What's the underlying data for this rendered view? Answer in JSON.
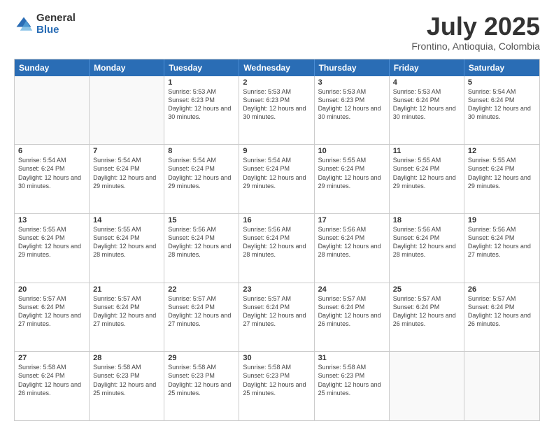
{
  "logo": {
    "general": "General",
    "blue": "Blue"
  },
  "title": "July 2025",
  "location": "Frontino, Antioquia, Colombia",
  "header_days": [
    "Sunday",
    "Monday",
    "Tuesday",
    "Wednesday",
    "Thursday",
    "Friday",
    "Saturday"
  ],
  "rows": [
    [
      {
        "day": "",
        "info": ""
      },
      {
        "day": "",
        "info": ""
      },
      {
        "day": "1",
        "info": "Sunrise: 5:53 AM\nSunset: 6:23 PM\nDaylight: 12 hours and 30 minutes."
      },
      {
        "day": "2",
        "info": "Sunrise: 5:53 AM\nSunset: 6:23 PM\nDaylight: 12 hours and 30 minutes."
      },
      {
        "day": "3",
        "info": "Sunrise: 5:53 AM\nSunset: 6:23 PM\nDaylight: 12 hours and 30 minutes."
      },
      {
        "day": "4",
        "info": "Sunrise: 5:53 AM\nSunset: 6:24 PM\nDaylight: 12 hours and 30 minutes."
      },
      {
        "day": "5",
        "info": "Sunrise: 5:54 AM\nSunset: 6:24 PM\nDaylight: 12 hours and 30 minutes."
      }
    ],
    [
      {
        "day": "6",
        "info": "Sunrise: 5:54 AM\nSunset: 6:24 PM\nDaylight: 12 hours and 30 minutes."
      },
      {
        "day": "7",
        "info": "Sunrise: 5:54 AM\nSunset: 6:24 PM\nDaylight: 12 hours and 29 minutes."
      },
      {
        "day": "8",
        "info": "Sunrise: 5:54 AM\nSunset: 6:24 PM\nDaylight: 12 hours and 29 minutes."
      },
      {
        "day": "9",
        "info": "Sunrise: 5:54 AM\nSunset: 6:24 PM\nDaylight: 12 hours and 29 minutes."
      },
      {
        "day": "10",
        "info": "Sunrise: 5:55 AM\nSunset: 6:24 PM\nDaylight: 12 hours and 29 minutes."
      },
      {
        "day": "11",
        "info": "Sunrise: 5:55 AM\nSunset: 6:24 PM\nDaylight: 12 hours and 29 minutes."
      },
      {
        "day": "12",
        "info": "Sunrise: 5:55 AM\nSunset: 6:24 PM\nDaylight: 12 hours and 29 minutes."
      }
    ],
    [
      {
        "day": "13",
        "info": "Sunrise: 5:55 AM\nSunset: 6:24 PM\nDaylight: 12 hours and 29 minutes."
      },
      {
        "day": "14",
        "info": "Sunrise: 5:55 AM\nSunset: 6:24 PM\nDaylight: 12 hours and 28 minutes."
      },
      {
        "day": "15",
        "info": "Sunrise: 5:56 AM\nSunset: 6:24 PM\nDaylight: 12 hours and 28 minutes."
      },
      {
        "day": "16",
        "info": "Sunrise: 5:56 AM\nSunset: 6:24 PM\nDaylight: 12 hours and 28 minutes."
      },
      {
        "day": "17",
        "info": "Sunrise: 5:56 AM\nSunset: 6:24 PM\nDaylight: 12 hours and 28 minutes."
      },
      {
        "day": "18",
        "info": "Sunrise: 5:56 AM\nSunset: 6:24 PM\nDaylight: 12 hours and 28 minutes."
      },
      {
        "day": "19",
        "info": "Sunrise: 5:56 AM\nSunset: 6:24 PM\nDaylight: 12 hours and 27 minutes."
      }
    ],
    [
      {
        "day": "20",
        "info": "Sunrise: 5:57 AM\nSunset: 6:24 PM\nDaylight: 12 hours and 27 minutes."
      },
      {
        "day": "21",
        "info": "Sunrise: 5:57 AM\nSunset: 6:24 PM\nDaylight: 12 hours and 27 minutes."
      },
      {
        "day": "22",
        "info": "Sunrise: 5:57 AM\nSunset: 6:24 PM\nDaylight: 12 hours and 27 minutes."
      },
      {
        "day": "23",
        "info": "Sunrise: 5:57 AM\nSunset: 6:24 PM\nDaylight: 12 hours and 27 minutes."
      },
      {
        "day": "24",
        "info": "Sunrise: 5:57 AM\nSunset: 6:24 PM\nDaylight: 12 hours and 26 minutes."
      },
      {
        "day": "25",
        "info": "Sunrise: 5:57 AM\nSunset: 6:24 PM\nDaylight: 12 hours and 26 minutes."
      },
      {
        "day": "26",
        "info": "Sunrise: 5:57 AM\nSunset: 6:24 PM\nDaylight: 12 hours and 26 minutes."
      }
    ],
    [
      {
        "day": "27",
        "info": "Sunrise: 5:58 AM\nSunset: 6:24 PM\nDaylight: 12 hours and 26 minutes."
      },
      {
        "day": "28",
        "info": "Sunrise: 5:58 AM\nSunset: 6:23 PM\nDaylight: 12 hours and 25 minutes."
      },
      {
        "day": "29",
        "info": "Sunrise: 5:58 AM\nSunset: 6:23 PM\nDaylight: 12 hours and 25 minutes."
      },
      {
        "day": "30",
        "info": "Sunrise: 5:58 AM\nSunset: 6:23 PM\nDaylight: 12 hours and 25 minutes."
      },
      {
        "day": "31",
        "info": "Sunrise: 5:58 AM\nSunset: 6:23 PM\nDaylight: 12 hours and 25 minutes."
      },
      {
        "day": "",
        "info": ""
      },
      {
        "day": "",
        "info": ""
      }
    ]
  ]
}
